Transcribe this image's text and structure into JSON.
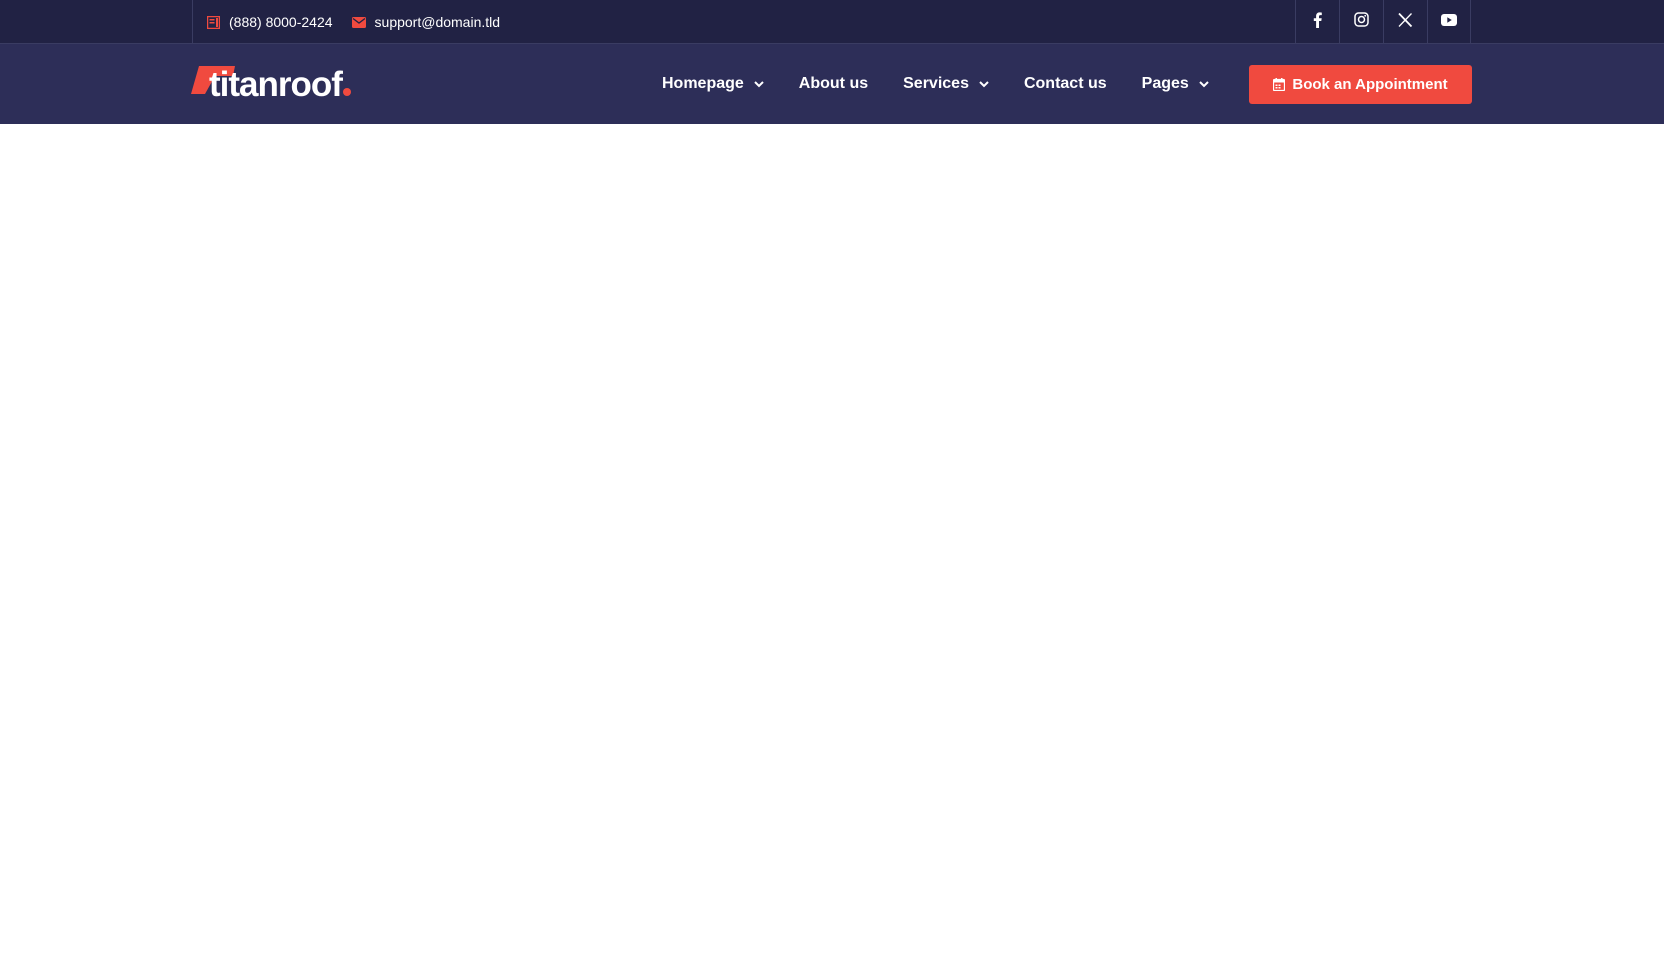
{
  "topbar": {
    "phone": "(888) 8000-2424",
    "email": "support@domain.tld",
    "phone_icon": "phone-book-icon",
    "email_icon": "envelope-icon",
    "socials": [
      "facebook-icon",
      "instagram-icon",
      "x-twitter-icon",
      "youtube-icon"
    ]
  },
  "logo": {
    "text": "titanroof"
  },
  "nav": {
    "items": [
      {
        "label": "Homepage",
        "dropdown": true
      },
      {
        "label": "About us",
        "dropdown": false
      },
      {
        "label": "Services",
        "dropdown": true
      },
      {
        "label": "Contact us",
        "dropdown": false
      },
      {
        "label": "Pages",
        "dropdown": true
      }
    ]
  },
  "cta": {
    "label": "Book an Appointment",
    "icon": "calendar-icon"
  },
  "colors": {
    "topbar_bg": "#212244",
    "navbar_bg": "#2d2e58",
    "accent": "#f04a3f",
    "text": "#ffffff"
  }
}
